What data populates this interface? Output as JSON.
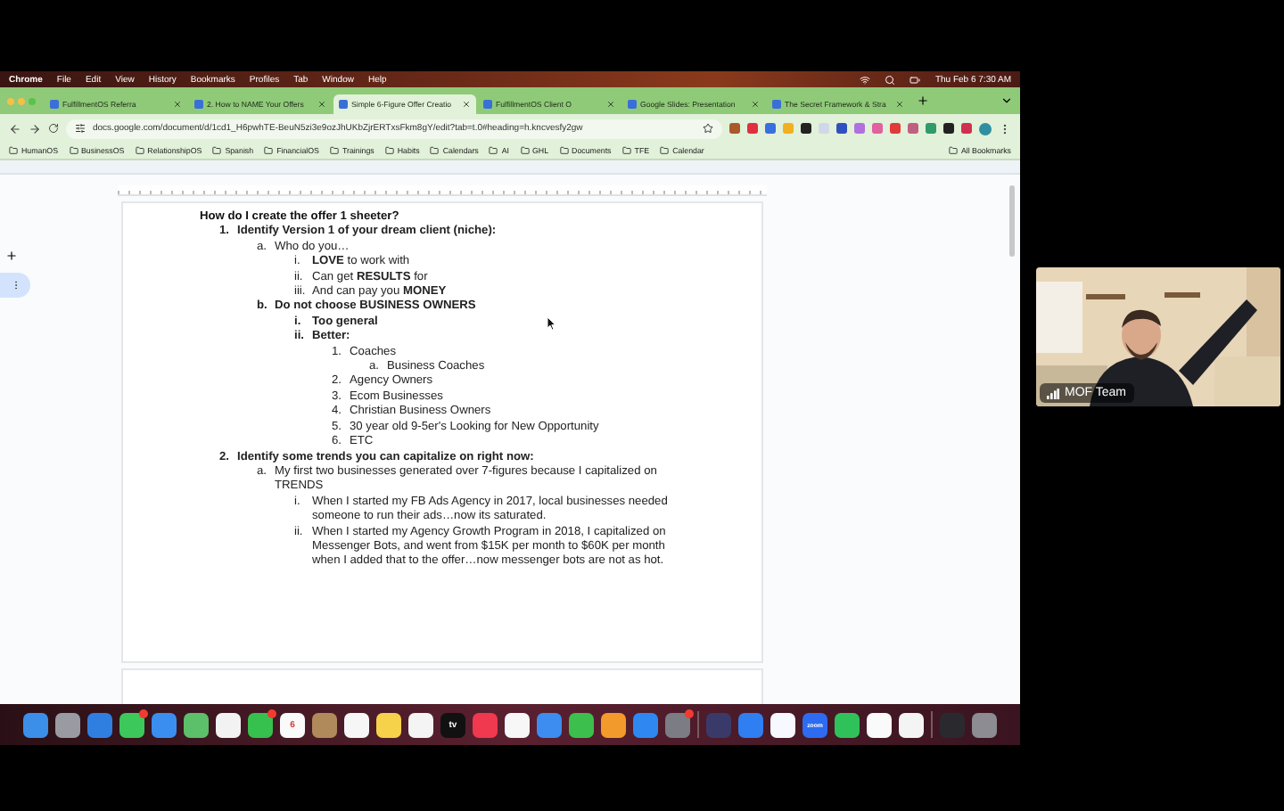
{
  "menu_bar": {
    "app": "Chrome",
    "menus": [
      "File",
      "Edit",
      "View",
      "History",
      "Bookmarks",
      "Profiles",
      "Tab",
      "Window",
      "Help"
    ],
    "clock": "Thu Feb 6  7:30 AM"
  },
  "tabs": [
    {
      "title": "FulfillmentOS Referra",
      "selected": false
    },
    {
      "title": "2. How to NAME Your Offers",
      "selected": false
    },
    {
      "title": "Simple 6-Figure Offer Creatio",
      "selected": true
    },
    {
      "title": "FulfillmentOS Client O",
      "selected": false
    },
    {
      "title": "Google Slides: Presentation",
      "selected": false
    },
    {
      "title": "The Secret Framework & Stra",
      "selected": false
    }
  ],
  "address_bar": {
    "url": "docs.google.com/document/d/1cd1_H6pwhTE-BeuN5zi3e9ozJhUKbZjrERTxsFkm8gY/edit?tab=t.0#heading=h.kncvesfy2gw"
  },
  "bookmarks": [
    "HumanOS",
    "BusinessOS",
    "RelationshipOS",
    "Spanish",
    "FinancialOS",
    "Trainings",
    "Habits",
    "Calendars",
    "AI",
    "GHL",
    "Documents",
    "TFE",
    "Calendar"
  ],
  "all_bookmarks": "All Bookmarks",
  "document": {
    "heading": "How do I create the offer 1 sheeter?",
    "items": [
      {
        "marker": "1.",
        "text": "Identify Version 1 of your dream client (niche):",
        "bold": true,
        "children": [
          {
            "marker": "a.",
            "text": "Who do you…",
            "bold": false,
            "children": [
              {
                "marker": "i.",
                "text": "**LOVE** to work with",
                "bold": false
              },
              {
                "marker": "ii.",
                "text": "Can get **RESULTS** for",
                "bold": false
              },
              {
                "marker": "iii.",
                "text": "And can pay you **MONEY**",
                "bold": false
              }
            ]
          },
          {
            "marker": "b.",
            "text": "Do not choose BUSINESS OWNERS",
            "bold": true,
            "children": [
              {
                "marker": "i.",
                "text": "Too general",
                "bold": true
              },
              {
                "marker": "ii.",
                "text": "Better:",
                "bold": true,
                "children": [
                  {
                    "marker": "1.",
                    "text": "Coaches",
                    "bold": false,
                    "children": [
                      {
                        "marker": "a.",
                        "text": "Business Coaches",
                        "bold": false
                      }
                    ]
                  },
                  {
                    "marker": "2.",
                    "text": "Agency Owners",
                    "bold": false
                  },
                  {
                    "marker": "3.",
                    "text": "Ecom Businesses",
                    "bold": false
                  },
                  {
                    "marker": "4.",
                    "text": "Christian Business Owners",
                    "bold": false
                  },
                  {
                    "marker": "5.",
                    "text": "30 year old 9-5er's Looking for New Opportunity",
                    "bold": false
                  },
                  {
                    "marker": "6.",
                    "text": "ETC",
                    "bold": false
                  }
                ]
              }
            ]
          }
        ]
      },
      {
        "marker": "2.",
        "text": "Identify some trends you can capitalize on right now:",
        "bold": true,
        "children": [
          {
            "marker": "a.",
            "text": "My first two businesses generated over 7-figures because I capitalized on TRENDS",
            "bold": false,
            "children": [
              {
                "marker": "i.",
                "text": "When I started my FB Ads Agency in 2017, local businesses needed someone to run their ads…now its saturated.",
                "bold": false
              },
              {
                "marker": "ii.",
                "text": "When I started my Agency Growth Program in 2018, I capitalized on Messenger Bots, and went from $15K per month to $60K per month when I added that to the offer…now messenger bots are not as hot.",
                "bold": false
              }
            ]
          }
        ]
      }
    ]
  },
  "dock": [
    [
      {
        "color": "#3b8fe8",
        "badge": false
      },
      {
        "color": "#9a9aa2",
        "badge": false
      },
      {
        "color": "#2f7fe0",
        "badge": false
      },
      {
        "color": "#3cc85a",
        "badge": true
      },
      {
        "color": "#3a8ef0",
        "badge": false
      },
      {
        "color": "#5cbf6a",
        "badge": false
      },
      {
        "color": "#f2f2f2",
        "badge": false
      },
      {
        "color": "#36c04e",
        "badge": true
      },
      {
        "color": "#fafafa",
        "badge": false,
        "label": "6"
      },
      {
        "color": "#b08a5a",
        "badge": false
      },
      {
        "color": "#f6f6f6",
        "badge": false
      },
      {
        "color": "#f5d24a",
        "badge": false
      },
      {
        "color": "#f4f4f4",
        "badge": false
      },
      {
        "color": "#111111",
        "badge": false,
        "label": "tv"
      },
      {
        "color": "#f0384e",
        "badge": false
      },
      {
        "color": "#f7f7f7",
        "badge": false
      },
      {
        "color": "#3d8cf0",
        "badge": false
      },
      {
        "color": "#3cbf4c",
        "badge": false
      },
      {
        "color": "#f39a2c",
        "badge": false
      },
      {
        "color": "#2f88f2",
        "badge": false
      },
      {
        "color": "#7c7c84",
        "badge": true
      }
    ],
    [
      {
        "color": "#3a3a6a",
        "badge": false
      },
      {
        "color": "#2f7ef2",
        "badge": false
      },
      {
        "color": "#f8f8ff",
        "badge": false
      },
      {
        "color": "#2d6cf0",
        "badge": false,
        "label": "zoom"
      },
      {
        "color": "#2fc25a",
        "badge": false
      },
      {
        "color": "#fafafa",
        "badge": false
      },
      {
        "color": "#f4f4f4",
        "badge": false
      }
    ],
    [
      {
        "color": "#2a2a2e",
        "badge": false
      },
      {
        "color": "#8c8c92",
        "badge": false
      }
    ]
  ],
  "video_tile": {
    "name": "MOF Team"
  }
}
